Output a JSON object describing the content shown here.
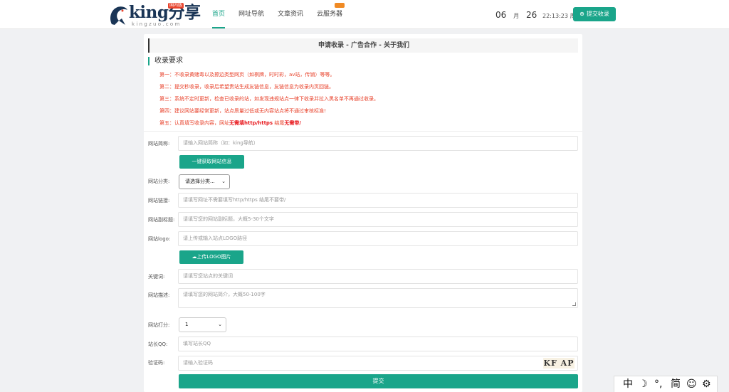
{
  "header": {
    "logo_text": "king分享",
    "logo_sub": "kingzuo.com",
    "logo_badge": "国内版",
    "nav": [
      {
        "label": "首页",
        "active": true
      },
      {
        "label": "网址导航"
      },
      {
        "label": "文章资讯"
      },
      {
        "label": "云服务器"
      }
    ],
    "date_month": "06",
    "date_month_unit": "月",
    "date_day": "26",
    "date_time": "22:13:23 周一",
    "submit_label": "提交收录"
  },
  "card": {
    "title": "申请收录 - 广告合作 - 关于我们",
    "section_title": "收录要求",
    "rules": [
      {
        "pre": "第一：不收录黄赌毒以及擦边类型网页（如棋牌，时时彩，av站，传销）等等。"
      },
      {
        "pre": "第二：提交秒收录，收录后希望贵站生成友链信息，友链信息为收录内页回链。"
      },
      {
        "pre": "第三：系统不定时更新，检查已收录的站，如发现违规站点一律下收录并拉入黑名单不再通过收录。"
      },
      {
        "pre": "第四：建议网站要经常更新，站点质量过低或无内容站点将不通过审核标准!"
      },
      {
        "pre": "第五：认真填写收录内容，网址",
        "bold1": "无需填http/https",
        "mid": " 结尾",
        "bold2": "无需带/"
      }
    ]
  },
  "form": {
    "site_name_label": "网站简称:",
    "site_name_placeholder": "请输入网站简称（如：king导航）",
    "fetch_button": "一键获取网站信息",
    "category_label": "网站分类:",
    "category_value": "请选择分类...",
    "url_label": "网站链接:",
    "url_placeholder": "请填写网址不需要填写http/https 结尾不要带/",
    "subtitle_label": "网站副标题:",
    "subtitle_placeholder": "请填写您的网站副标题，大概5-30个文字",
    "logo_label": "网站logo:",
    "logo_placeholder": "请上传或输入站点LOGO路径",
    "upload_button": "上传LOGO图片",
    "keywords_label": "关键词:",
    "keywords_placeholder": "请填写您站点的关键词",
    "desc_label": "网站描述:",
    "desc_placeholder": "请填写您的网站简介，大概50-100字",
    "score_label": "网站打分:",
    "score_value": "1",
    "qq_label": "站长QQ:",
    "qq_placeholder": "填写站长QQ",
    "captcha_label": "验证码:",
    "captcha_placeholder": "请输入验证码",
    "captcha_image_text": "KF AP",
    "submit_label": "提交"
  },
  "ime": {
    "items": [
      "中",
      "☽",
      "°,",
      "简",
      "☺",
      "⚙"
    ]
  },
  "colors": {
    "accent": "#1aa58a",
    "warning": "#e8432c"
  }
}
